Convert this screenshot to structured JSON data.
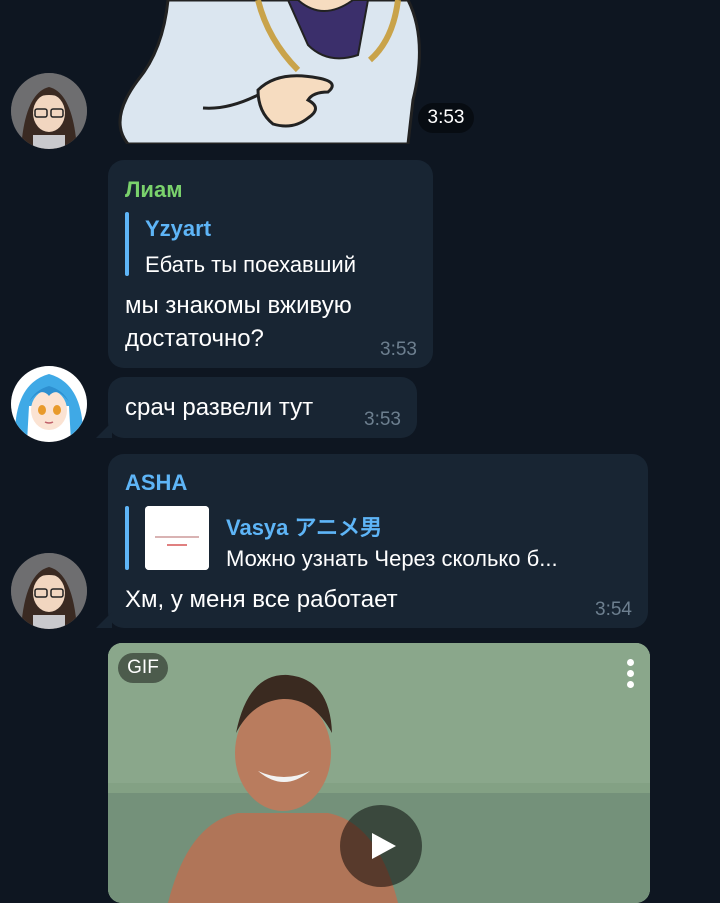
{
  "messages": [
    {
      "id": "sticker",
      "time": "3:53"
    },
    {
      "id": "liam",
      "sender": "Лиам",
      "sender_color": "#7ad26c",
      "reply_name": "Yzyart",
      "reply_text": "Ебать ты поехавший",
      "text_line1": "мы знакомы вживую",
      "text_line2": "достаточно?",
      "time": "3:53"
    },
    {
      "id": "srach",
      "text": "срач развели тут",
      "time": "3:53"
    },
    {
      "id": "asha",
      "sender": "ASHA",
      "sender_color": "#5eb5f7",
      "reply_name": "Vasya アニメ男",
      "reply_text": "Можно узнать Через сколько б...",
      "text": "Хм, у меня все работает",
      "time": "3:54"
    }
  ],
  "gif": {
    "badge": "GIF",
    "play_icon": "play-icon",
    "menu_icon": "more-vertical-icon"
  },
  "colors": {
    "background": "#0e1621",
    "bubble": "#182533",
    "reply_accent": "#5eb5f7",
    "time": "#6d7f8f"
  }
}
